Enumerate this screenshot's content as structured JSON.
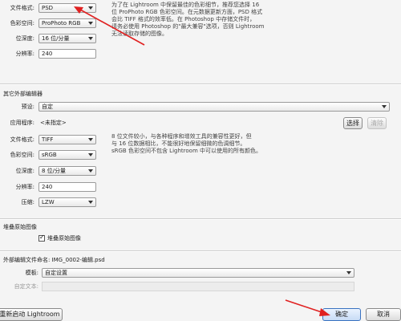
{
  "top": {
    "file_format_label": "文件格式:",
    "file_format_value": "PSD",
    "color_space_label": "色彩空间:",
    "color_space_value": "ProPhoto RGB",
    "bit_depth_label": "位深度:",
    "bit_depth_value": "16 位/分量",
    "resolution_label": "分辨率:",
    "resolution_value": "240",
    "note_lines": [
      "为了在 Lightroom 中保留最佳的色彩细节，推荐您选择 16",
      "位 ProPhoto RGB 色彩空间。在元数据更新方面，PSD 格式",
      "会比 TIFF 格式的效率低。在 Photoshop 中存储文件时，",
      "请务必使用 Photoshop 的\"最大兼容\"选项，否则 Lightroom",
      "无法读取存储的图像。"
    ]
  },
  "other_editor": {
    "section_title": "其它外部编辑器",
    "preset_label": "预设:",
    "preset_value": "自定",
    "app_label": "应用程序:",
    "app_value": "<未指定>",
    "choose_button": "选择",
    "clear_button": "清除",
    "file_format_label": "文件格式:",
    "file_format_value": "TIFF",
    "color_space_label": "色彩空间:",
    "color_space_value": "sRGB",
    "bit_depth_label": "位深度:",
    "bit_depth_value": "8 位/分量",
    "resolution_label": "分辨率:",
    "resolution_value": "240",
    "compression_label": "压缩:",
    "compression_value": "LZW",
    "note_lines": [
      "8 位文件较小，与各种程序和增效工具的兼容性更好，但",
      "与 16 位数据相比，不能很好地保留细微的色调细节。",
      "sRGB 色彩空间不包含 Lightroom 中可以使用的所有颜色。"
    ]
  },
  "stack": {
    "section_title": "堆叠原始图像",
    "checkbox_label": "堆叠原始图像",
    "checked": true
  },
  "naming": {
    "section_title": "外部编辑文件命名: IMG_0002-编辑.psd",
    "template_label": "模板:",
    "template_value": "自定设置",
    "custom_text_label": "自定文本:"
  },
  "footer": {
    "restart_button": "重新启动 Lightroom",
    "ok_button": "确定",
    "cancel_button": "取消"
  },
  "colors": {
    "arrow": "#e02020",
    "primary_border": "#3a72c0"
  }
}
